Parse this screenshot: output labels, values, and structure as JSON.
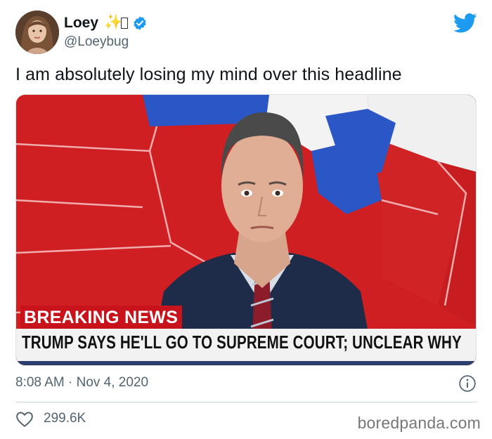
{
  "author": {
    "display_name": "Loey",
    "emoji": "✨",
    "handle": "@Loeybug",
    "verified": true
  },
  "tweet": {
    "text": "I am absolutely losing my mind over this headline",
    "timestamp": "8:08 AM · Nov 4, 2020",
    "likes": "299.6K"
  },
  "media": {
    "banner": "BREAKING NEWS",
    "headline": "TRUMP SAYS HE'LL GO TO SUPREME COURT; UNCLEAR WHY"
  },
  "watermark": "boredpanda.com",
  "colors": {
    "twitter_blue": "#1d9bf0",
    "breaking_red": "#c8131c",
    "text_secondary": "#536471"
  },
  "icons": [
    "twitter-bird-icon",
    "verified-badge-icon",
    "info-icon",
    "heart-icon"
  ]
}
